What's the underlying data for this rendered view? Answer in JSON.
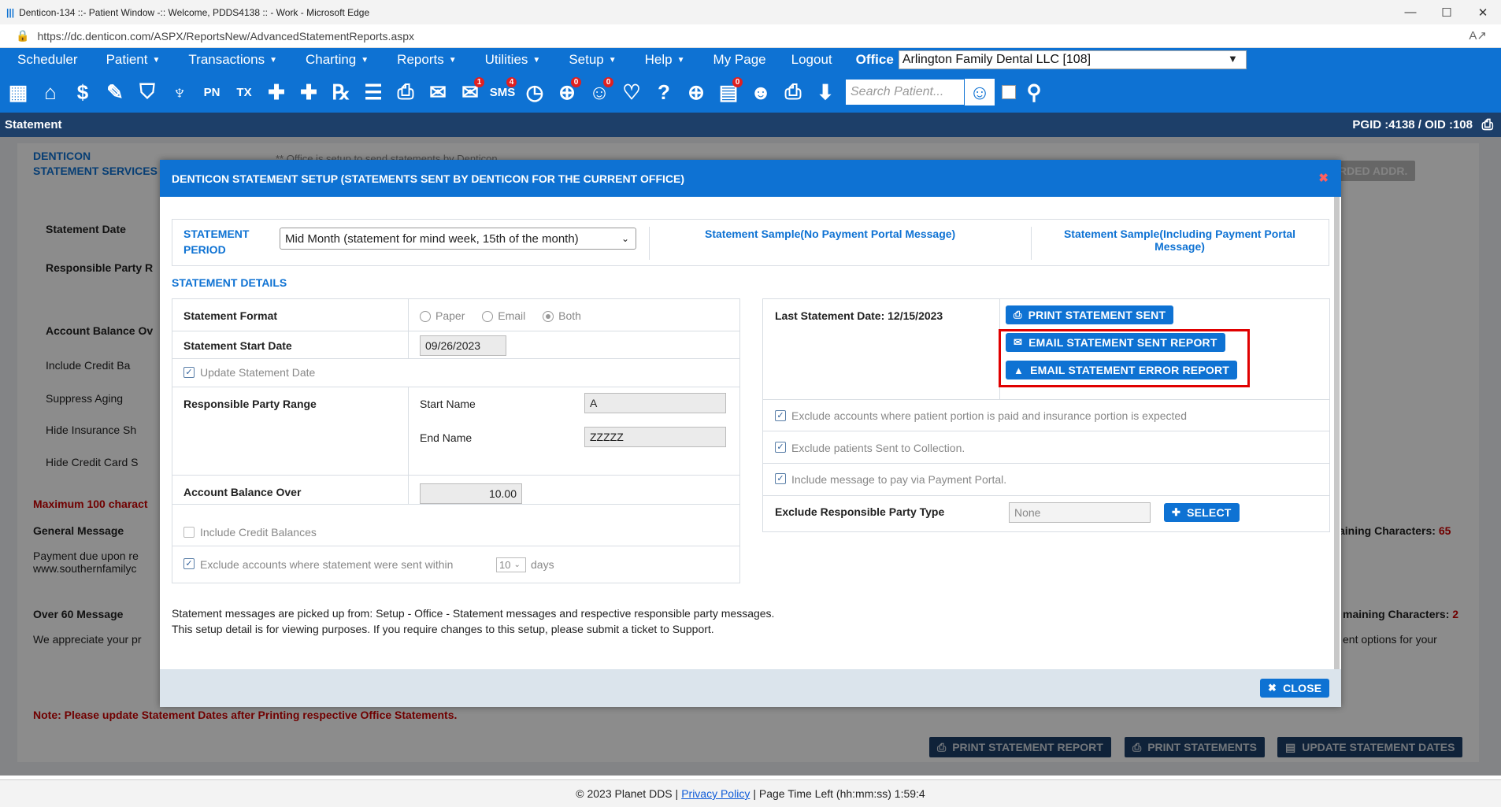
{
  "window": {
    "title": "Denticon-134 ::- Patient Window -:: Welcome, PDDS4138 :: - Work - Microsoft Edge",
    "url": "https://dc.denticon.com/ASPX/ReportsNew/AdvancedStatementReports.aspx"
  },
  "menu": {
    "items": [
      {
        "label": "Scheduler",
        "caret": ""
      },
      {
        "label": "Patient",
        "caret": "▼"
      },
      {
        "label": "Transactions",
        "caret": "▼"
      },
      {
        "label": "Charting",
        "caret": "▼"
      },
      {
        "label": "Reports",
        "caret": "▼"
      },
      {
        "label": "Utilities",
        "caret": "▼"
      },
      {
        "label": "Setup",
        "caret": "▼"
      },
      {
        "label": "Help",
        "caret": "▼"
      },
      {
        "label": "My Page",
        "caret": ""
      },
      {
        "label": "Logout",
        "caret": ""
      }
    ],
    "office_label": "Office",
    "office_value": "Arlington Family Dental LLC [108]"
  },
  "toolbar": {
    "search_placeholder": "Search Patient...",
    "pn": "PN",
    "tx": "TX",
    "rx": "℞",
    "sms": "SMS",
    "badge_msg": "1",
    "badge_sms": "4",
    "badge_globe": "0",
    "badge_person": "0",
    "badge_doc": "0"
  },
  "statusbar": {
    "title": "Statement",
    "ids": "PGID :4138  /  OID :108"
  },
  "background": {
    "svc_title1": "DENTICON",
    "svc_title2": "STATEMENT SERVICES",
    "notice": "** Office is setup to send statements by Denticon",
    "fwd_btn": "RDED ADDR.",
    "stmt_date": "Statement Date",
    "resp_party": "Responsible Party R",
    "acct_bal": "Account Balance Ov",
    "inc_credit": "Include Credit Ba",
    "suppress": "Suppress Aging",
    "hide_ins": "Hide Insurance Sh",
    "hide_cc": "Hide Credit Card S",
    "max_chars": "Maximum 100 charact",
    "gen_msg": "General Message",
    "gen_msg_text": "Payment due upon re\nwww.southernfamilyc",
    "remain1_lbl": "aining Characters:",
    "remain1_val": "65",
    "over60": "Over 60 Message",
    "over60_text": "We appreciate your pr",
    "remain2_lbl": "maining Characters:",
    "remain2_val": "2",
    "over60_right": "ent options for your",
    "note": "Note: Please update Statement Dates after Printing respective Office Statements.",
    "btn_print_report": "PRINT STATEMENT REPORT",
    "btn_print_stmts": "PRINT STATEMENTS",
    "btn_update": "UPDATE STATEMENT DATES"
  },
  "modal": {
    "title": "DENTICON STATEMENT SETUP (STATEMENTS SENT BY DENTICON FOR THE CURRENT OFFICE)",
    "period_label1": "STATEMENT",
    "period_label2": "PERIOD",
    "period_value": "Mid Month (statement for mind week, 15th of the month)",
    "sample_no_portal": "Statement Sample(No Payment Portal Message)",
    "sample_portal1": "Statement Sample(Including Payment Portal",
    "sample_portal2": "Message)",
    "details_title": "STATEMENT DETAILS",
    "format_label": "Statement Format",
    "fmt_paper": "Paper",
    "fmt_email": "Email",
    "fmt_both": "Both",
    "start_date_label": "Statement Start Date",
    "start_date_value": "09/26/2023",
    "update_date": "Update Statement Date",
    "range_label": "Responsible Party Range",
    "start_name_label": "Start Name",
    "start_name_value": "A",
    "end_name_label": "End Name",
    "end_name_value": "ZZZZZ",
    "bal_over_label": "Account Balance Over",
    "bal_over_value": "10.00",
    "inc_credit": "Include Credit Balances",
    "exclude_sent": "Exclude accounts where statement were sent within",
    "exclude_days_value": "10",
    "days": "days",
    "last_stmt": "Last Statement Date: 12/15/2023",
    "btn_print_sent": "PRINT STATEMENT SENT",
    "btn_email_sent": "EMAIL STATEMENT SENT REPORT",
    "btn_email_error": "EMAIL STATEMENT ERROR REPORT",
    "excl_patient_paid": "Exclude accounts where patient portion is paid and insurance portion is expected",
    "excl_collection": "Exclude patients Sent to Collection.",
    "inc_portal": "Include message to pay via Payment Portal.",
    "excl_type_label": "Exclude Responsible Party Type",
    "excl_type_value": "None",
    "btn_select": "SELECT",
    "msg1": "Statement messages are picked up from: Setup - Office - Statement messages and respective responsible party messages.",
    "msg2": "This setup detail is for viewing purposes. If you require changes to this setup, please submit a ticket to Support.",
    "btn_close": "CLOSE"
  },
  "footer": {
    "copyright": "© 2023 Planet DDS |",
    "privacy": "Privacy Policy",
    "time": "| Page Time Left (hh:mm:ss) 1:59:4"
  },
  "colors": {
    "brand": "#0e72d3",
    "dark": "#1d3f69",
    "alert": "#e00000"
  }
}
